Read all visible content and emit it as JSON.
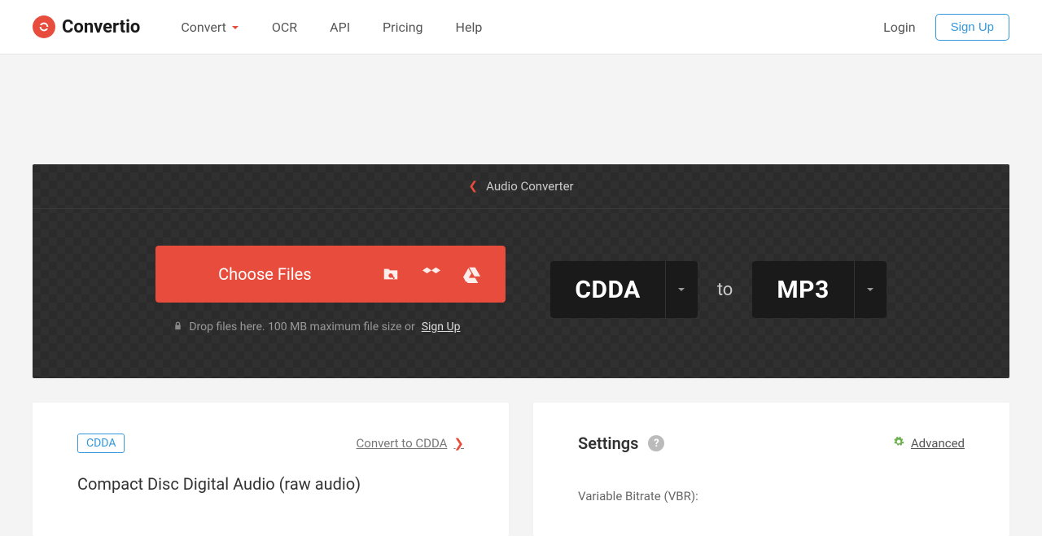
{
  "logo_text": "Convertio",
  "nav": {
    "convert": "Convert",
    "ocr": "OCR",
    "api": "API",
    "pricing": "Pricing",
    "help": "Help"
  },
  "auth": {
    "login": "Login",
    "signup": "Sign Up"
  },
  "breadcrumb": "Audio Converter",
  "choose_label": "Choose Files",
  "drop_hint_prefix": "Drop files here. 100 MB maximum file size or ",
  "drop_signup": "Sign Up",
  "source_format": "CDDA",
  "to_word": "to",
  "target_format": "MP3",
  "left_card": {
    "badge": "CDDA",
    "convert_link": "Convert to CDDA",
    "desc": "Compact Disc Digital Audio (raw audio)"
  },
  "right_card": {
    "title": "Settings",
    "advanced": "Advanced",
    "vbr_label": "Variable Bitrate (VBR):"
  }
}
